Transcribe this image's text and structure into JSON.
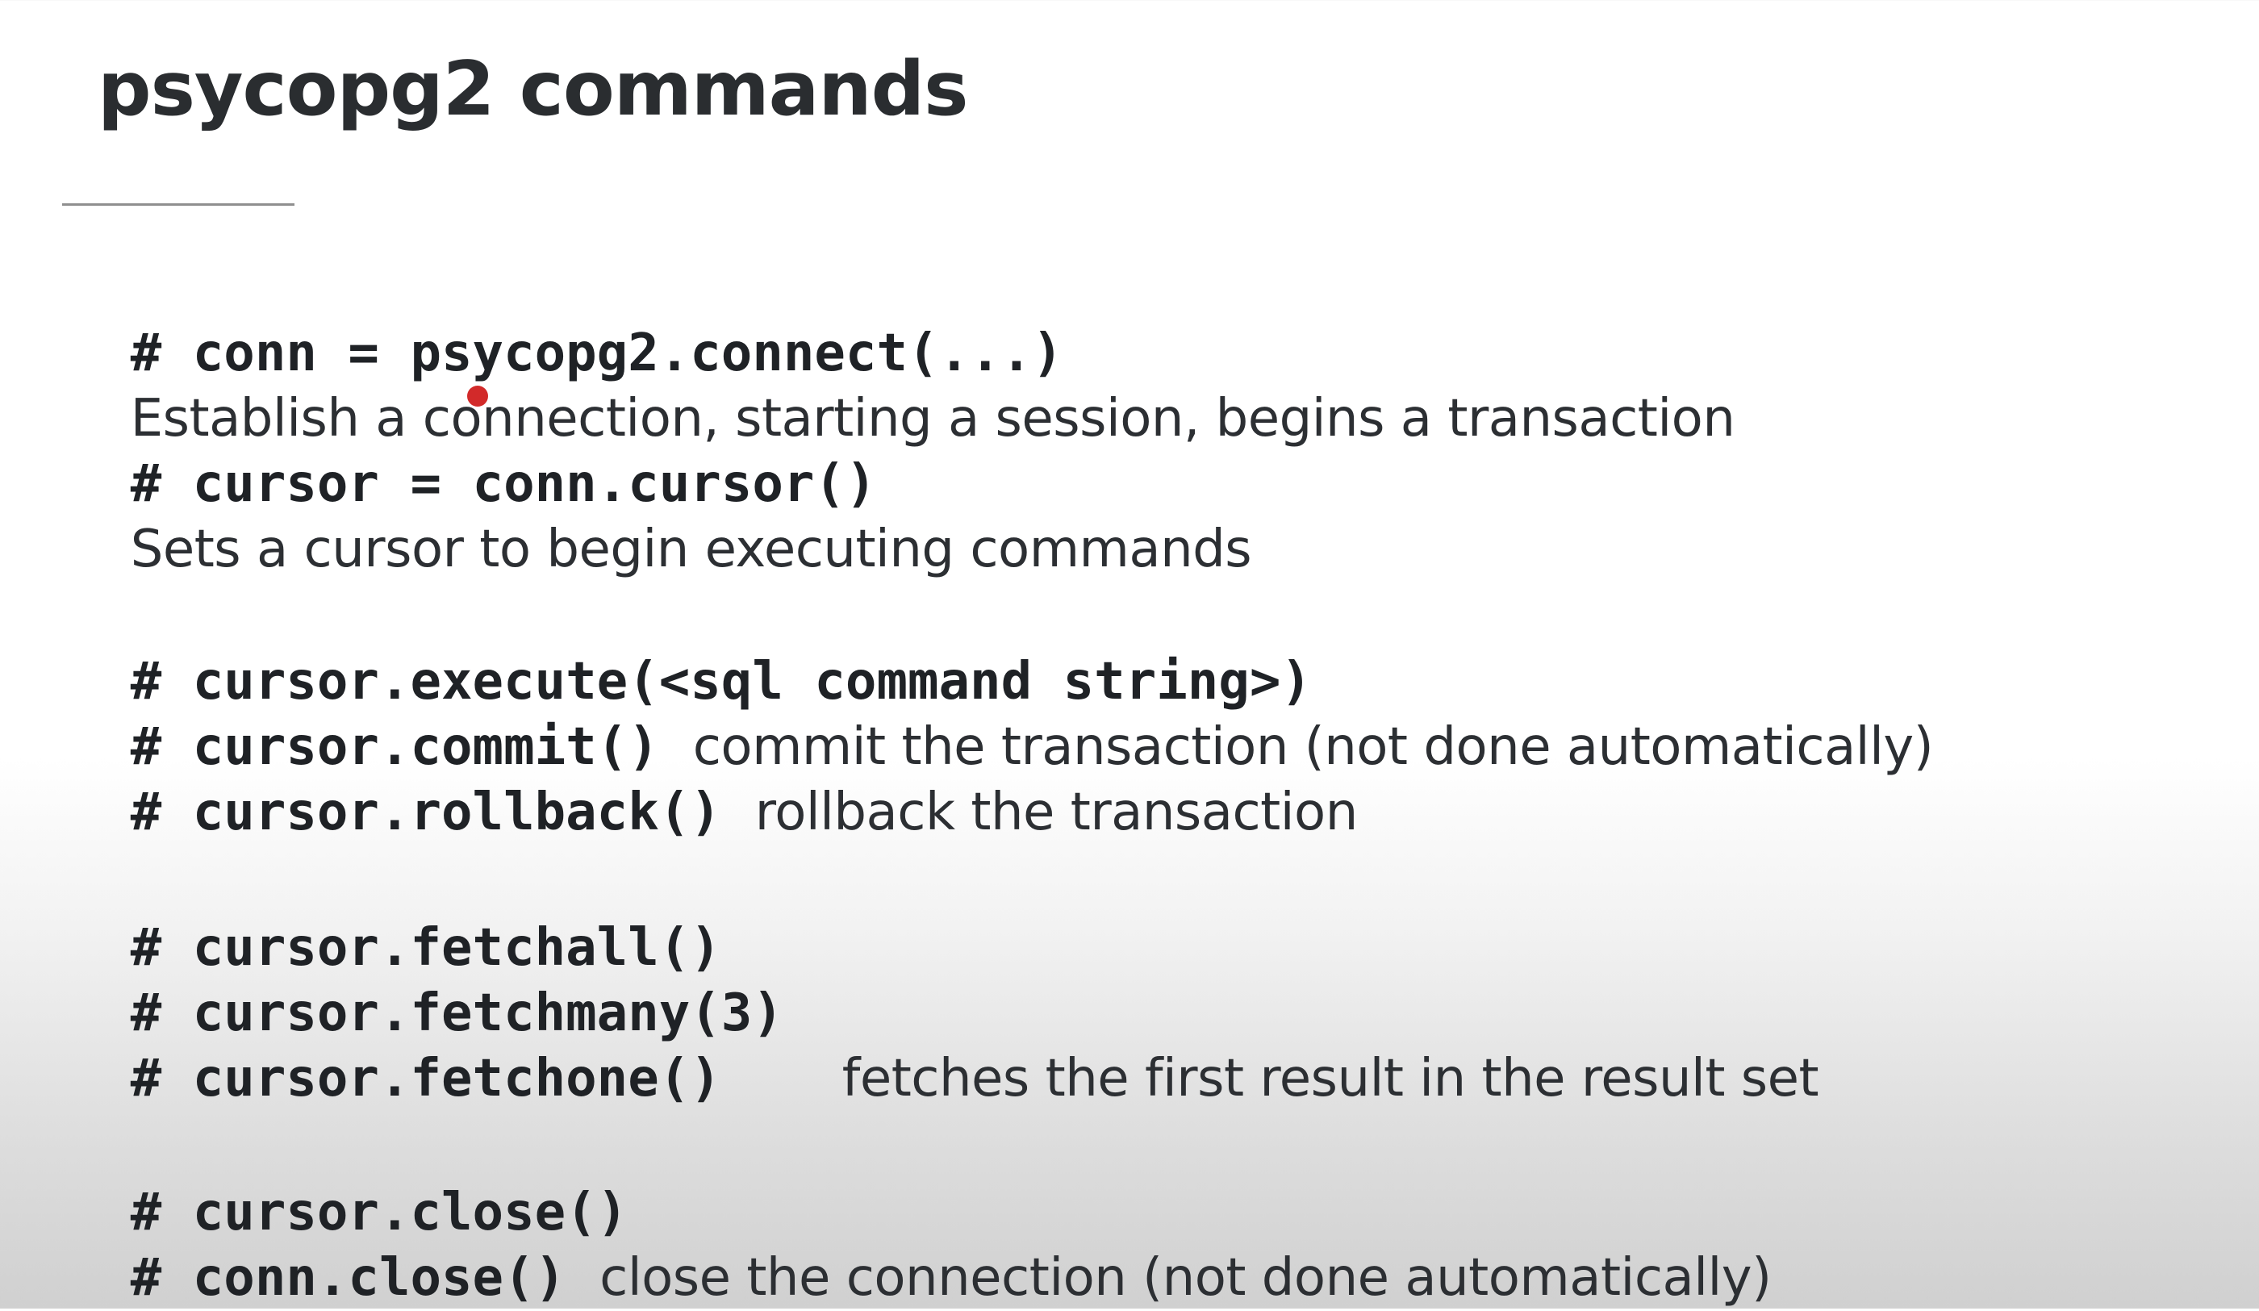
{
  "slide": {
    "title": "psycopg2 commands"
  },
  "lines": [
    {
      "code": "# conn = psycopg2.connect(...)"
    },
    {
      "desc": "Establish a connection, starting a session, begins a transaction"
    },
    {
      "code": "# cursor = conn.cursor()"
    },
    {
      "desc": "Sets a cursor to begin executing commands"
    },
    {
      "code": "# cursor.execute(<sql command string>)"
    },
    {
      "code": "# cursor.commit()",
      "desc": "commit the transaction (not done automatically)"
    },
    {
      "code": "# cursor.rollback()",
      "desc": "rollback the transaction"
    },
    {
      "code": "# cursor.fetchall()"
    },
    {
      "code": "# cursor.fetchmany(3)"
    },
    {
      "code": "# cursor.fetchone()",
      "desc": "fetches the first result in the result set"
    },
    {
      "code": "# cursor.close()"
    },
    {
      "code": "# conn.close()",
      "desc": "close the connection (not done automatically)"
    }
  ],
  "pointer": {
    "color": "#d22a2a"
  }
}
